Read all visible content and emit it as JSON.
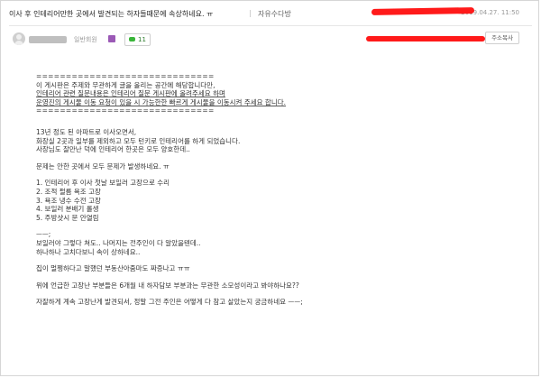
{
  "post": {
    "title": "이사 후 인테리어만한 곳에서 발견되는 하자들때문에 속상하네요. ㅠ",
    "separator": "|",
    "board": "자유수다방",
    "date": "2019.04.27. 11:50"
  },
  "author": {
    "member_level": "일반회원",
    "comment_count": "11",
    "action_label": "주소복사"
  },
  "content": {
    "divider": "==============================",
    "notice_lines": [
      "이 게시판은 주제와 무관하게 글을 올리는 공간에 해당합니다만,",
      "인테리어 관련 질문내용은 인테리어 질문 게시판에 올려주세요 하며",
      "운영진의 게시물 이동 요청이 있을 시 가능한한 빠르게 게시물을 이동시켜 주세요 합니다."
    ],
    "para1": [
      "13년 정도 된 아파트로 이사오면서,",
      "화장실 2곳과 일부를 제외하고 모두 턴키로 인테리어를 하게 되었습니다.",
      "사장님도 잘만난 덕에 인테리어 한곳은 모두 양호한데.."
    ],
    "para2": "문제는 안한 곳에서 모두 문제가 발생하네요. ㅠ",
    "issues": [
      "1. 인테리어 후 이사 첫날 보일러 고장으로 수리",
      "2. 조적 펄름 욕조 고장",
      "3. 욕조 냉수 수전 고장",
      "4. 보일러 분배기 롤생",
      "5. 주방샷시 문 안열림"
    ],
    "para3": [
      "ㅡㅡ;",
      "보일러야 그렇다 쳐도.. 나머지는 전주인이 다 알았을텐데..",
      "하나하나 고치다보니 속이 상하네요.."
    ],
    "para4": "집이 멀쩡하다고 말했던 부동산아줌마도 짜증나고 ㅠㅠ",
    "para5": "위에 언급한 고장난 부분들은 6개월 내 하자담보 부분과는 무관한 소모성이라고 봐야하나요??",
    "para6": "자잘하게 계속 고장난게 발견되서, 정말 그전 주인은 어떻게 다 참고 살았는지 궁금하네요 ㅡㅡ;"
  },
  "colors": {
    "redaction": "#ff1a1a",
    "level_badge": "#9b59b6",
    "comment_icon": "#39b539"
  },
  "icons": {
    "avatar": "default-avatar-icon",
    "level": "member-level-icon",
    "comment": "comment-bubble-icon"
  }
}
